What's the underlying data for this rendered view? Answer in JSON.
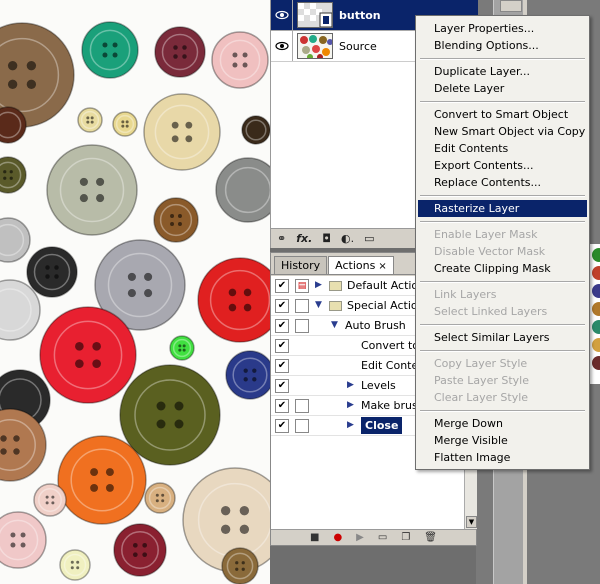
{
  "layers": [
    {
      "name": "button",
      "selected": true,
      "visible_icon": "eye-icon"
    },
    {
      "name": "Source",
      "selected": false,
      "visible_icon": "eye-icon"
    }
  ],
  "layers_footer_icons": [
    "link-icon",
    "fx-icon",
    "mask-icon",
    "adjustment-icon",
    "folder-icon"
  ],
  "layers_footer_labels": {
    "link": "⚭",
    "fx": "fx.",
    "mask": "◘",
    "adjust": "◐.",
    "folder": "▭"
  },
  "actions_panel": {
    "tabs": [
      {
        "label": "History",
        "active": false
      },
      {
        "label": "Actions",
        "active": true
      }
    ],
    "tab_close": "×",
    "rows": [
      {
        "label": "Default Actions",
        "level": 0,
        "expanded": false,
        "folder": true,
        "dialog": true
      },
      {
        "label": "Special Actions",
        "level": 0,
        "expanded": true,
        "folder": true,
        "dialog": false
      },
      {
        "label": "Auto Brush",
        "level": 1,
        "expanded": true,
        "folder": false,
        "dialog": false
      },
      {
        "label": "Convert to",
        "level": 2,
        "expanded": null,
        "folder": false,
        "dialog": false
      },
      {
        "label": "Edit Conte",
        "level": 2,
        "expanded": null,
        "folder": false,
        "dialog": false
      },
      {
        "label": "Levels",
        "level": 2,
        "expanded": false,
        "folder": false,
        "dialog": false
      },
      {
        "label": "Make brus",
        "level": 2,
        "expanded": false,
        "folder": false,
        "dialog": true
      },
      {
        "label": "Close",
        "level": 2,
        "expanded": false,
        "folder": false,
        "dialog": true,
        "selected": true
      }
    ],
    "footer_icons": [
      "stop-icon",
      "record-icon",
      "play-icon",
      "new-set-icon",
      "new-action-icon",
      "trash-icon"
    ],
    "footer_labels": {
      "stop": "■",
      "record": "●",
      "play": "▶",
      "set": "▭",
      "action": "❐",
      "trash": "🗑"
    }
  },
  "context_menu": {
    "groups": [
      [
        {
          "label": "Layer Properties...",
          "enabled": true
        },
        {
          "label": "Blending Options...",
          "enabled": true
        }
      ],
      [
        {
          "label": "Duplicate Layer...",
          "enabled": true
        },
        {
          "label": "Delete Layer",
          "enabled": true
        }
      ],
      [
        {
          "label": "Convert to Smart Object",
          "enabled": true
        },
        {
          "label": "New Smart Object via Copy",
          "enabled": true
        },
        {
          "label": "Edit Contents",
          "enabled": true
        },
        {
          "label": "Export Contents...",
          "enabled": true
        },
        {
          "label": "Replace Contents...",
          "enabled": true
        }
      ],
      [
        {
          "label": "Rasterize Layer",
          "enabled": true,
          "highlighted": true
        }
      ],
      [
        {
          "label": "Enable Layer Mask",
          "enabled": false
        },
        {
          "label": "Disable Vector Mask",
          "enabled": false
        },
        {
          "label": "Create Clipping Mask",
          "enabled": true
        }
      ],
      [
        {
          "label": "Link Layers",
          "enabled": false
        },
        {
          "label": "Select Linked Layers",
          "enabled": false
        }
      ],
      [
        {
          "label": "Select Similar Layers",
          "enabled": true
        }
      ],
      [
        {
          "label": "Copy Layer Style",
          "enabled": false
        },
        {
          "label": "Paste Layer Style",
          "enabled": false
        },
        {
          "label": "Clear Layer Style",
          "enabled": false
        }
      ],
      [
        {
          "label": "Merge Down",
          "enabled": true
        },
        {
          "label": "Merge Visible",
          "enabled": true
        },
        {
          "label": "Flatten Image",
          "enabled": true
        }
      ]
    ]
  },
  "colors": {
    "selection": "#0a246a",
    "panel": "#d4d0c8",
    "menu_bg": "#f2f1ec",
    "disabled_text": "#a6a6a6"
  }
}
